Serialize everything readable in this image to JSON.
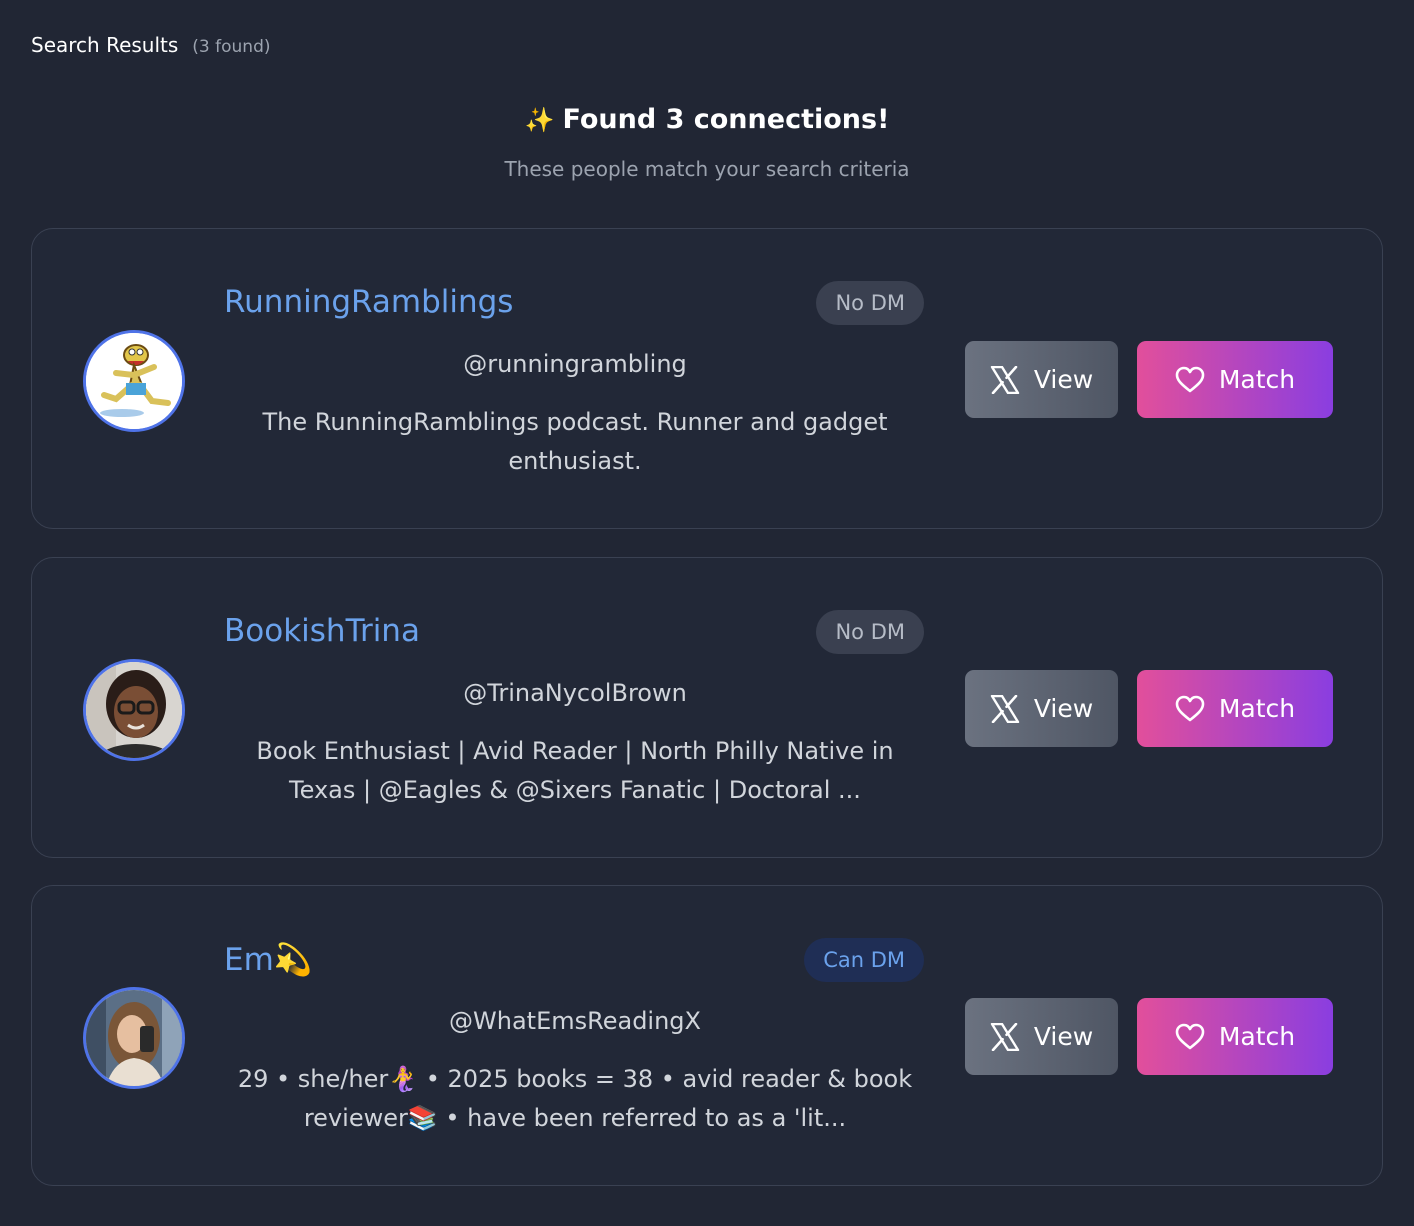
{
  "header": {
    "title": "Search Results",
    "count": "(3 found)"
  },
  "summary": {
    "title": "Found 3 connections!",
    "subtitle": "These people match your search criteria",
    "icon": "sparkles-icon"
  },
  "colors": {
    "accent": "#6ba2ec",
    "match_start": "#e24f9b",
    "match_end": "#8a3ee0",
    "background": "#212634"
  },
  "results": [
    {
      "name": "RunningRamblings",
      "badge": "No DM",
      "handle": "@runningrambling",
      "bio": "The RunningRamblings podcast. Runner and gadget enthusiast.",
      "view_label": "View",
      "match_label": "Match"
    },
    {
      "name": "BookishTrina",
      "badge": "No DM",
      "handle": "@TrinaNycolBrown",
      "bio": "Book Enthusiast | Avid Reader | North Philly Native in Texas | @Eagles & @Sixers Fanatic | Doctoral ...",
      "view_label": "View",
      "match_label": "Match"
    },
    {
      "name": "Em💫",
      "badge": "Can DM",
      "handle": "@WhatEmsReadingX",
      "bio": "29 • she/her🧜‍♀️ • 2025 books = 38 • avid reader & book reviewer📚 • have been referred to as a 'lit...",
      "view_label": "View",
      "match_label": "Match"
    }
  ]
}
